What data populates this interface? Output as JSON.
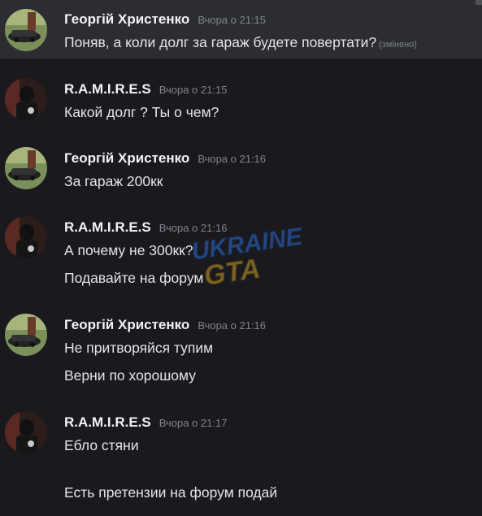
{
  "messages": [
    {
      "author": "Георгій Христенко",
      "timestamp": "Вчора о 21:15",
      "lines": [
        "Поняв, а коли долг за гараж будете повертати?"
      ],
      "edited_label": "(змінено)"
    },
    {
      "author": "R.A.M.I.R.E.S",
      "timestamp": "Вчора о 21:15",
      "lines": [
        "Какой долг ? Ты о чем?"
      ]
    },
    {
      "author": "Георгій Христенко",
      "timestamp": "Вчора о 21:16",
      "lines": [
        "За гараж 200кк"
      ]
    },
    {
      "author": "R.A.M.I.R.E.S",
      "timestamp": "Вчора о 21:16",
      "lines": [
        "А почему не 300кк?",
        "Подавайте на форум"
      ]
    },
    {
      "author": "Георгій Христенко",
      "timestamp": "Вчора о 21:16",
      "lines": [
        "Не притворяйся тупим",
        "Верни по хорошому"
      ]
    },
    {
      "author": "R.A.M.I.R.E.S",
      "timestamp": "Вчора о 21:17",
      "lines": [
        "Ебло стяни",
        "Есть претензии на форум подай"
      ]
    }
  ],
  "watermark": {
    "line1": "UKRAINE",
    "line2": "GTA"
  },
  "colors": {
    "background": "#1a1a1e",
    "hover": "#2b2d31",
    "username": "#f2f3f5",
    "timestamp": "#80848e",
    "text": "#e3e5e8"
  }
}
